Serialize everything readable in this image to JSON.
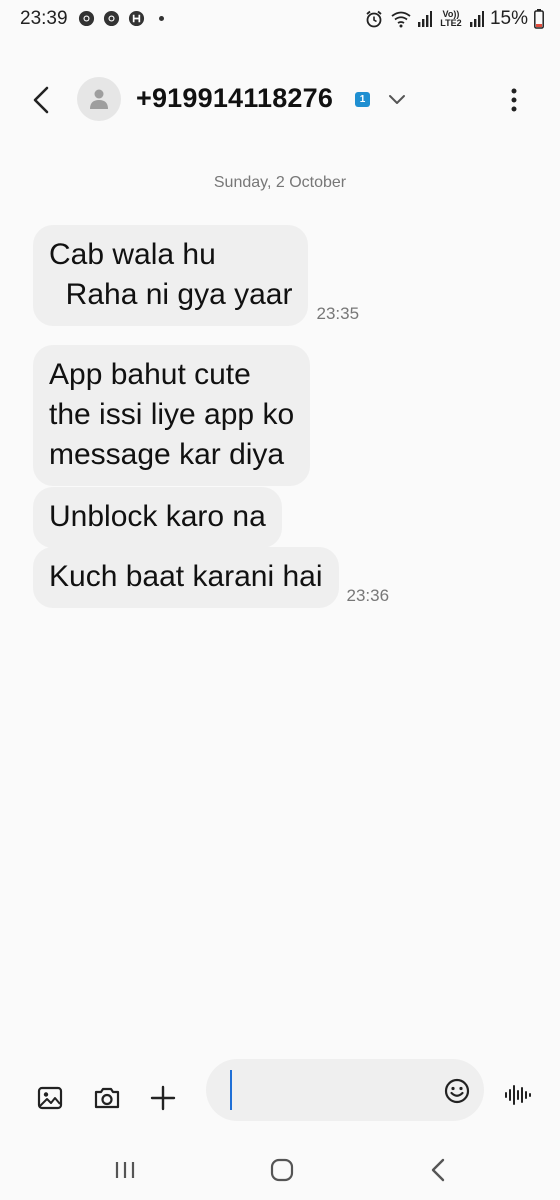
{
  "status_bar": {
    "time": "23:39",
    "battery_percent": "15%",
    "network_label": "Vo)) LTE2",
    "notification_icons": [
      "chrome-icon",
      "chrome-icon",
      "hotstar-icon"
    ]
  },
  "header": {
    "contact": "+919914118276",
    "sim_badge": "1",
    "icons": {
      "back": "back-arrow-icon",
      "avatar": "person-icon",
      "expand": "chevron-down-icon",
      "more": "more-vertical-icon"
    }
  },
  "conversation": {
    "date_separator": "Sunday, 2 October",
    "messages": [
      {
        "text": "Cab wala hu\n  Raha ni gya yaar",
        "time": "23:35"
      },
      {
        "text": "App bahut cute\nthe issi liye app ko\nmessage kar diya",
        "time": ""
      },
      {
        "text": "Unblock karo na",
        "time": ""
      },
      {
        "text": "Kuch baat karani hai",
        "time": "23:36"
      }
    ]
  },
  "composer": {
    "input_value": "",
    "icons": [
      "gallery-icon",
      "camera-icon",
      "plus-icon",
      "emoji-icon",
      "voice-icon"
    ]
  },
  "nav_bar": {
    "icons": [
      "recents-icon",
      "home-icon",
      "back-icon"
    ]
  },
  "colors": {
    "background": "#fafafa",
    "bubble": "#efefef",
    "accent": "#1f6fd6",
    "sim_badge": "#1f8fd1"
  }
}
